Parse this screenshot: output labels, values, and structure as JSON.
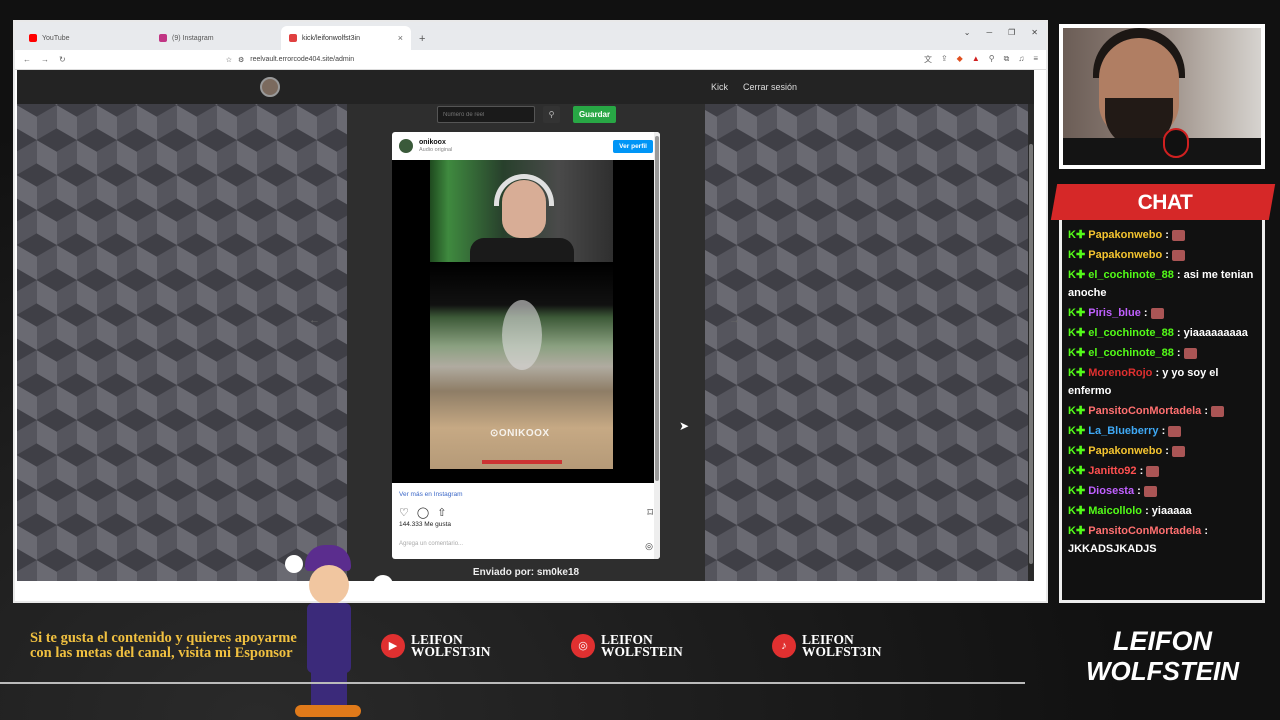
{
  "browser": {
    "tabs": [
      {
        "label": "YouTube",
        "color": "#ff0000"
      },
      {
        "label": "(9) Instagram",
        "color": "#c13584"
      },
      {
        "label": "kick/leifonwolfst3in",
        "color": "#e04040"
      }
    ],
    "new_tab": "+",
    "url": "reelvault.errorcode404.site/admin"
  },
  "page": {
    "nav_kick": "Kick",
    "nav_logout": "Cerrar sesión",
    "reel_placeholder": "Número de reel",
    "save_label": "Guardar",
    "sent_by": "Enviado por: sm0ke18"
  },
  "insta": {
    "username": "onikoox",
    "audio": "Audio original",
    "view_profile": "Ver perfil",
    "watermark": "⊙ONIKOOX",
    "see_more": "Ver más en Instagram",
    "likes": "144.333 Me gusta",
    "comment_placeholder": "Agrega un comentario..."
  },
  "chat": {
    "title": "CHAT",
    "messages": [
      {
        "user": "Papakonwebo",
        "color": "#f4c430",
        "text": ""
      },
      {
        "user": "Papakonwebo",
        "color": "#f4c430",
        "text": ""
      },
      {
        "user": "el_cochinote_88",
        "color": "#53fc18",
        "text": "asi me tenian anoche"
      },
      {
        "user": "Piris_blue",
        "color": "#c060ff",
        "text": ""
      },
      {
        "user": "el_cochinote_88",
        "color": "#53fc18",
        "text": "yiaaaaaaaaa"
      },
      {
        "user": "el_cochinote_88",
        "color": "#53fc18",
        "text": ""
      },
      {
        "user": "MorenoRojo",
        "color": "#e03030",
        "text": "y yo soy el enfermo"
      },
      {
        "user": "PansitoConMortadela",
        "color": "#ff7070",
        "text": ""
      },
      {
        "user": "La_Blueberry",
        "color": "#3fa9f5",
        "text": ""
      },
      {
        "user": "Papakonwebo",
        "color": "#f4c430",
        "text": ""
      },
      {
        "user": "Janitto92",
        "color": "#ff5050",
        "text": ""
      },
      {
        "user": "Diosesta",
        "color": "#c060ff",
        "text": ""
      },
      {
        "user": "Maicollolo",
        "color": "#53fc18",
        "text": "yiaaaaa"
      },
      {
        "user": "PansitoConMortadela",
        "color": "#ff7070",
        "text": "JKKADSJKADJS"
      }
    ]
  },
  "footer": {
    "sponsor": "Si te gusta el contenido y quieres apoyarme con las metas del canal, visita mi Esponsor",
    "socials": [
      {
        "icon": "youtube-icon",
        "line1": "LEIFON",
        "line2": "WOLFST3IN"
      },
      {
        "icon": "instagram-icon",
        "line1": "LEIFON",
        "line2": "WOLFSTEIN"
      },
      {
        "icon": "tiktok-icon",
        "line1": "LEIFON",
        "line2": "WOLFST3IN"
      }
    ],
    "brand_line1": "LEIFON",
    "brand_line2": "WOLFSTEIN"
  }
}
